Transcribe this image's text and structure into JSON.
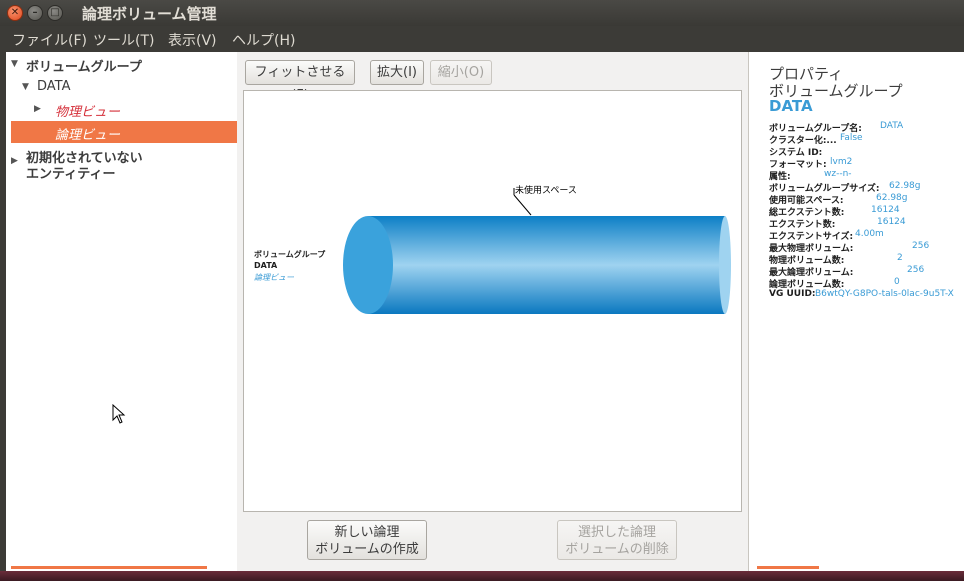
{
  "window": {
    "title": "論理ボリューム管理"
  },
  "menu": [
    "ファイル(F)",
    "ツール(T)",
    "表示(V)",
    "ヘルプ(H)"
  ],
  "tree": {
    "root": "ボリュームグループ",
    "group": "DATA",
    "physical_view": "物理ビュー",
    "logical_view": "論理ビュー",
    "uninit_line1": "初期化されていない",
    "uninit_line2": "エンティティー"
  },
  "toolbar": {
    "fit": "フィットさせる(F)",
    "zoom_in": "拡大(I)",
    "zoom_out": "縮小(O)"
  },
  "diagram": {
    "unused_label": "未使用スペース",
    "vg_label": "ボリュームグループ",
    "vg_name": "DATA",
    "view_label": "論理ビュー",
    "colors": {
      "cylinder": "#1e8fd4",
      "cap": "#3aa2dc",
      "view_label": "#3a9bd5"
    }
  },
  "actions": {
    "create_line1": "新しい論理",
    "create_line2": "ボリュームの作成",
    "delete_line1": "選択した論理",
    "delete_line2": "ボリュームの削除"
  },
  "properties": {
    "title1": "プロパティ",
    "title2": "ボリュームグループ",
    "name": "DATA",
    "rows": [
      {
        "label": "ボリュームグループ名:",
        "value": "DATA"
      },
      {
        "label": "クラスター化:...",
        "value": "False"
      },
      {
        "label": "システム ID:",
        "value": ""
      },
      {
        "label": "フォーマット:",
        "value": "lvm2"
      },
      {
        "label": "属性:",
        "value": "wz--n-"
      },
      {
        "label": "ボリュームグループサイズ:",
        "value": "62.98g"
      },
      {
        "label": "使用可能スペース:",
        "value": "62.98g"
      },
      {
        "label": "総エクステント数:",
        "value": "16124"
      },
      {
        "label": "エクステント数:",
        "value": "16124"
      },
      {
        "label": "エクステントサイズ:",
        "value": "4.00m"
      },
      {
        "label": "最大物理ボリューム:",
        "value": "256"
      },
      {
        "label": "物理ボリューム数:",
        "value": "2"
      },
      {
        "label": "最大論理ボリューム:",
        "value": "256"
      },
      {
        "label": "論理ボリューム数:",
        "value": "0"
      },
      {
        "label": "VG UUID:",
        "value": "B6wtQY-G8PO-tals-0lac-9u5T-X"
      }
    ]
  },
  "colors": {
    "accent": "#f07746",
    "link": "#3a9bd5"
  }
}
